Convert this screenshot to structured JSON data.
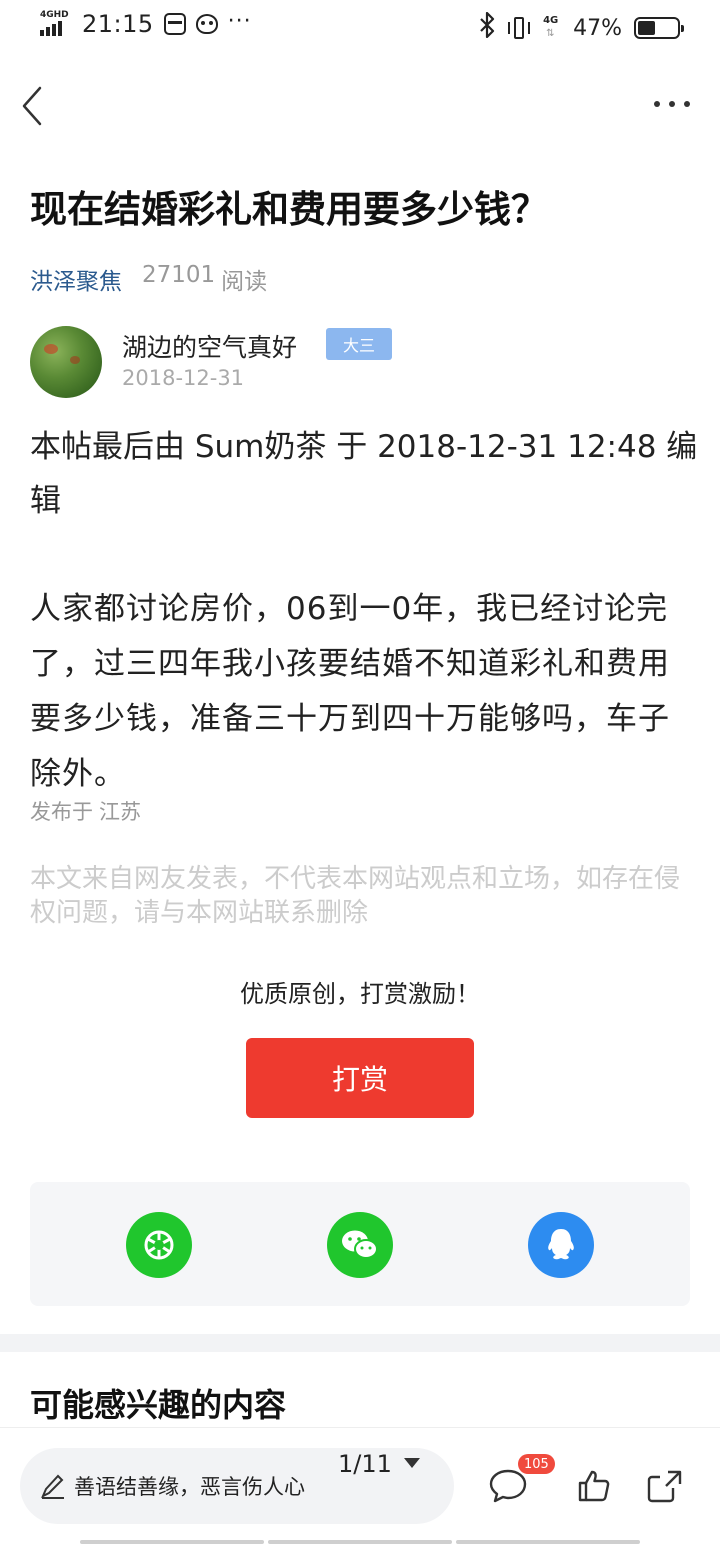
{
  "status_bar": {
    "network_label": "4GHD",
    "time": "21:15",
    "net_type": "4G",
    "battery_pct": "47%",
    "battery_level": 0.47
  },
  "article": {
    "title": "现在结婚彩礼和费用要多少钱？",
    "forum": "洪泽聚焦",
    "read_count": "27101",
    "read_label": "阅读",
    "author": "湖边的空气真好",
    "level": "大三",
    "date": "2018-12-31",
    "edit_note": "本帖最后由 Sum奶茶 于 2018-12-31 12:48 编辑",
    "body": "人家都讨论房价，06到一0年，我已经讨论完了，过三四年我小孩要结婚不知道彩礼和费用要多少钱，准备三十万到四十万能够吗，车子除外。",
    "location_prefix": "发布于",
    "location": "江苏",
    "disclaimer": "本文来自网友发表，不代表本网站观点和立场，如存在侵权问题，请与本网站联系删除"
  },
  "reward": {
    "caption": "优质原创，打赏激励！",
    "button": "打赏"
  },
  "share": {
    "items": [
      "moments-icon",
      "wechat-icon",
      "qq-icon"
    ]
  },
  "related": {
    "title": "可能感兴趣的内容"
  },
  "toolbar": {
    "comment_placeholder": "善语结善缘，恶言伤人心",
    "page": "1/11",
    "comment_count": "105"
  },
  "colors": {
    "accent_red": "#ee3a2f",
    "link_blue": "#2b5a8e",
    "badge_blue": "#8cb7ef",
    "wechat_green": "#20c62d",
    "qq_blue": "#2d8cf0"
  }
}
